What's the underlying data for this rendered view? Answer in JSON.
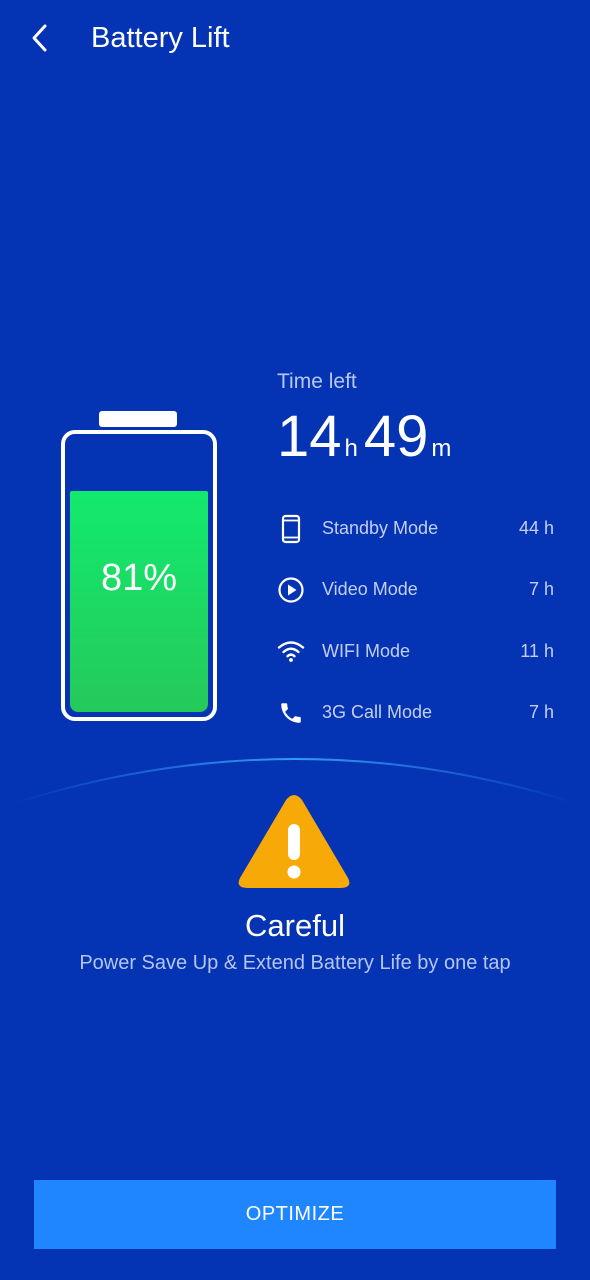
{
  "header": {
    "title": "Battery Lift",
    "back_icon": "chevron-left-icon"
  },
  "battery": {
    "level_percent": 81,
    "label": "81%",
    "fill_color_top": "#12ea6e",
    "fill_color_bottom": "#25c95a"
  },
  "time_left": {
    "label": "Time left",
    "hours": "14",
    "hours_unit": "h",
    "minutes": "49",
    "minutes_unit": "m"
  },
  "modes": [
    {
      "icon": "smartphone-icon",
      "label": "Standby Mode",
      "value": "44 h"
    },
    {
      "icon": "play-circle-icon",
      "label": "Video Mode",
      "value": "7 h"
    },
    {
      "icon": "wifi-icon",
      "label": "WIFI Mode",
      "value": "11 h"
    },
    {
      "icon": "phone-icon",
      "label": "3G Call Mode",
      "value": "7 h"
    }
  ],
  "status": {
    "icon": "warning-icon",
    "title": "Careful",
    "subtitle": "Power Save Up & Extend Battery Life by one tap"
  },
  "action": {
    "optimize_label": "OPTIMIZE"
  },
  "colors": {
    "background": "#0434b4",
    "button": "#1f86ff",
    "warning": "#f7aa07",
    "arc": "#3aa6ff"
  }
}
